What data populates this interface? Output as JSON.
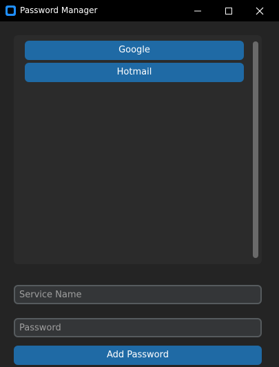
{
  "window": {
    "title": "Password Manager",
    "icon": "app-icon",
    "controls": [
      "minimize-icon",
      "maximize-icon",
      "close-icon"
    ]
  },
  "services": {
    "items": [
      {
        "label": "Google"
      },
      {
        "label": "Hotmail"
      }
    ]
  },
  "form": {
    "service_name": {
      "value": "",
      "placeholder": "Service Name"
    },
    "password": {
      "value": "",
      "placeholder": "Password"
    },
    "add_label": "Add Password"
  },
  "colors": {
    "accent": "#1f6aa5",
    "background": "#242424",
    "frame": "#2b2b2b",
    "titlebar": "#000000",
    "entry_border": "#565b5e"
  }
}
